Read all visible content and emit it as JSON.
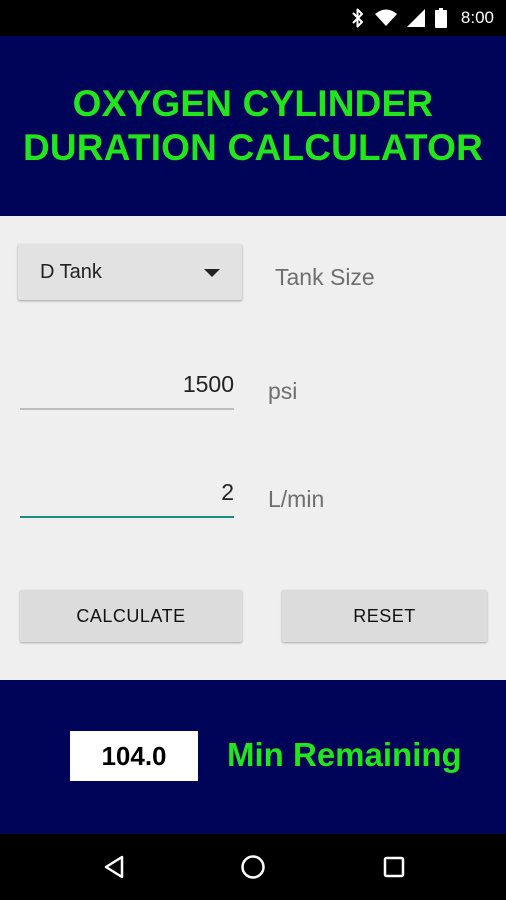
{
  "status_bar": {
    "time": "8:00",
    "icons": [
      "bluetooth-icon",
      "wifi-icon",
      "cell-signal-icon",
      "battery-icon"
    ]
  },
  "header": {
    "title_line1": "OXYGEN CYLINDER",
    "title_line2": "DURATION CALCULATOR"
  },
  "form": {
    "tank_size": {
      "selected": "D Tank",
      "label": "Tank Size"
    },
    "pressure": {
      "value": "1500",
      "unit": "psi"
    },
    "flow": {
      "value": "2",
      "unit": "L/min"
    },
    "buttons": {
      "calculate": "CALCULATE",
      "reset": "RESET"
    }
  },
  "result": {
    "value": "104.0",
    "label": "Min Remaining"
  },
  "nav_bar": {
    "icons": [
      "back-icon",
      "home-icon",
      "recent-apps-icon"
    ]
  },
  "colors": {
    "header_bg": "#000459",
    "accent_green": "#22e51b",
    "focus_underline": "#1a8c7c"
  }
}
